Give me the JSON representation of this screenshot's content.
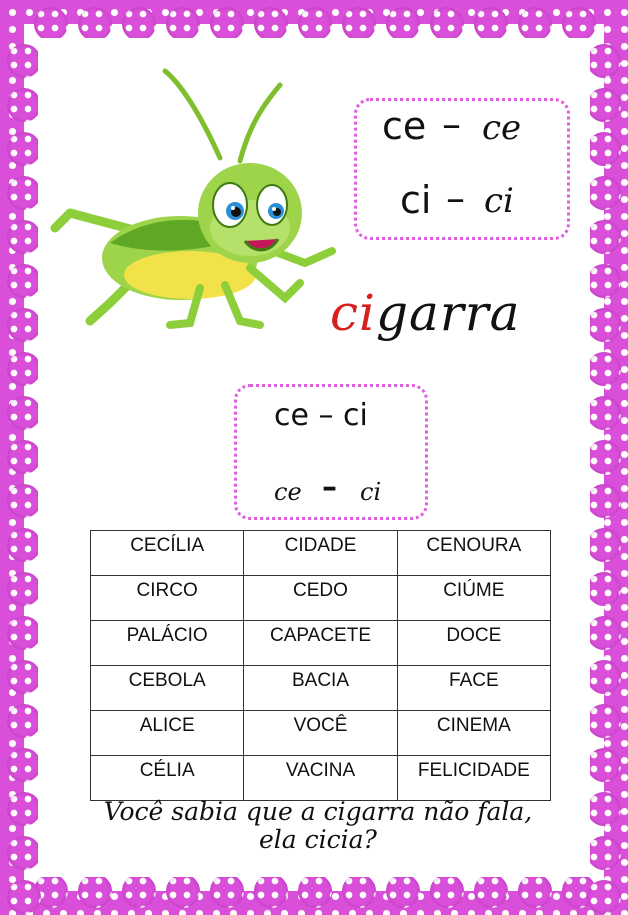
{
  "syllables_top": {
    "print_ce": "ce",
    "dash": "–",
    "script_ce": "ce",
    "print_ci": "ci",
    "script_ci": "ci"
  },
  "word": {
    "highlight": "ci",
    "rest": "garra",
    "highlight_color": "#d61f1f"
  },
  "syllables_mid": {
    "print_line": "ce – ci",
    "script_ce": "ce",
    "dash": "–",
    "script_ci": "ci"
  },
  "table": {
    "rows": [
      [
        "CECÍLIA",
        "CIDADE",
        "CENOURA"
      ],
      [
        "CIRCO",
        "CEDO",
        "CIÚME"
      ],
      [
        "PALÁCIO",
        "CAPACETE",
        "DOCE"
      ],
      [
        "CEBOLA",
        "BACIA",
        "FACE"
      ],
      [
        "ALICE",
        "VOCÊ",
        "CINEMA"
      ],
      [
        "CÉLIA",
        "VACINA",
        "FELICIDADE"
      ]
    ]
  },
  "footer": {
    "line1": "Você sabia que a cigarra não fala,",
    "line2": "ela cicia?"
  },
  "colors": {
    "border_pink": "#d94fd9",
    "dot_box": "#e05ce0",
    "cricket_green": "#8ccf3a"
  },
  "icons": {
    "illustration": "cricket-cartoon"
  }
}
